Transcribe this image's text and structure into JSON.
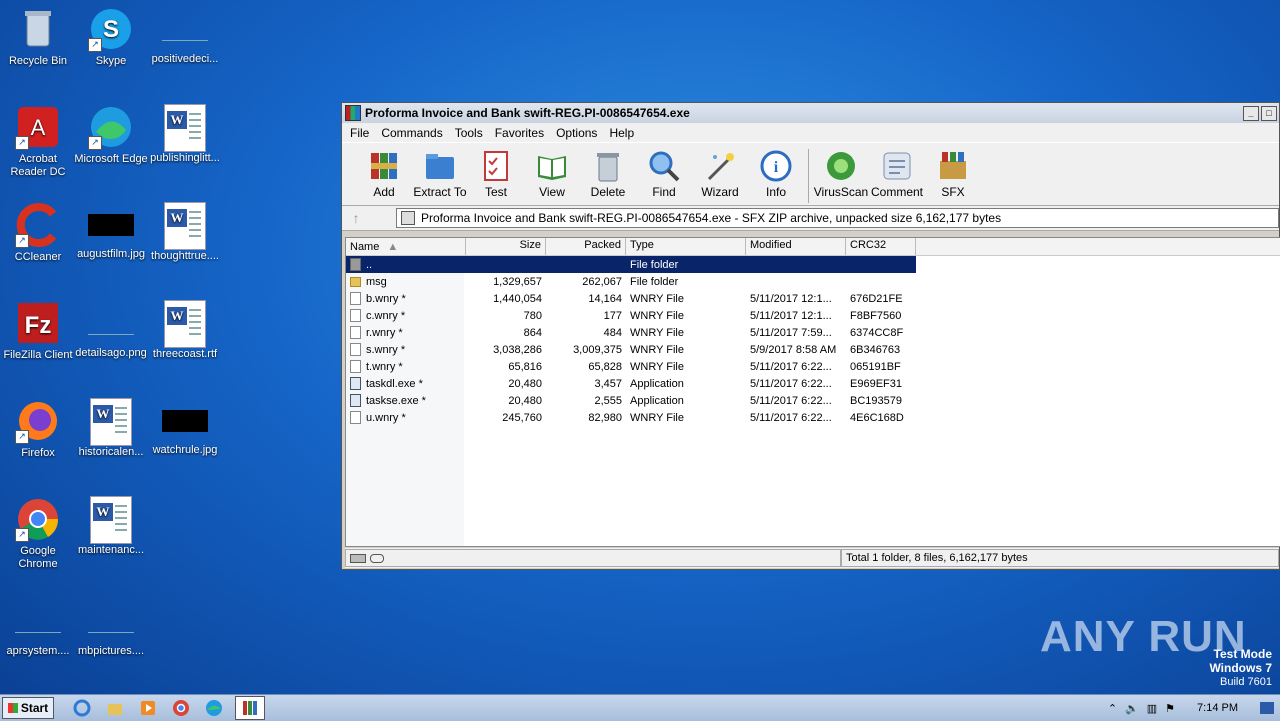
{
  "desktop": {
    "icons": [
      {
        "label": "Recycle Bin",
        "icon": "recycle-bin-icon"
      },
      {
        "label": "Skype",
        "icon": "skype-icon"
      },
      {
        "label": "positivedeci...",
        "icon": "image-file-icon"
      },
      {
        "label": "Acrobat Reader DC",
        "icon": "acrobat-icon"
      },
      {
        "label": "Microsoft Edge",
        "icon": "edge-icon"
      },
      {
        "label": "publishinglitt...",
        "icon": "word-doc-icon"
      },
      {
        "label": "CCleaner",
        "icon": "ccleaner-icon"
      },
      {
        "label": "augustfilm.jpg",
        "icon": "image-file-icon"
      },
      {
        "label": "thoughttrue....",
        "icon": "word-doc-icon"
      },
      {
        "label": "FileZilla Client",
        "icon": "filezilla-icon"
      },
      {
        "label": "detailsago.png",
        "icon": "image-file-icon"
      },
      {
        "label": "threecoast.rtf",
        "icon": "word-doc-icon"
      },
      {
        "label": "Firefox",
        "icon": "firefox-icon"
      },
      {
        "label": "historicalen...",
        "icon": "word-doc-icon"
      },
      {
        "label": "watchrule.jpg",
        "icon": "image-file-icon"
      },
      {
        "label": "Google Chrome",
        "icon": "chrome-icon"
      },
      {
        "label": "maintenanc...",
        "icon": "word-doc-icon"
      },
      {
        "label": "aprsystem....",
        "icon": "image-file-icon"
      },
      {
        "label": "mbpictures....",
        "icon": "image-file-icon"
      }
    ]
  },
  "window": {
    "title": "Proforma Invoice and Bank swift-REG.PI-0086547654.exe",
    "menu": [
      "File",
      "Commands",
      "Tools",
      "Favorites",
      "Options",
      "Help"
    ],
    "toolbar": [
      {
        "label": "Add",
        "icon": "add-archive-icon",
        "color": "#b8342a"
      },
      {
        "label": "Extract To",
        "icon": "extract-folder-icon",
        "color": "#3a7fd0"
      },
      {
        "label": "Test",
        "icon": "test-checklist-icon",
        "color": "#c43a3a"
      },
      {
        "label": "View",
        "icon": "view-book-icon",
        "color": "#3a8a3a"
      },
      {
        "label": "Delete",
        "icon": "trash-icon",
        "color": "#8a96a6"
      },
      {
        "label": "Find",
        "icon": "magnifier-icon",
        "color": "#2f6fc0"
      },
      {
        "label": "Wizard",
        "icon": "wand-icon",
        "color": "#6aa0d8"
      },
      {
        "label": "Info",
        "icon": "info-icon",
        "color": "#2d6cc4"
      },
      {
        "label": "VirusScan",
        "icon": "virus-scan-icon",
        "color": "#3c9a3c"
      },
      {
        "label": "Comment",
        "icon": "comment-icon",
        "color": "#7a8fb0"
      },
      {
        "label": "SFX",
        "icon": "sfx-box-icon",
        "color": "#c99a44"
      }
    ],
    "address": "Proforma Invoice and Bank swift-REG.PI-0086547654.exe - SFX ZIP archive, unpacked size 6,162,177 bytes",
    "columns": {
      "name": "Name",
      "size": "Size",
      "packed": "Packed",
      "type": "Type",
      "modified": "Modified",
      "crc": "CRC32"
    },
    "files": [
      {
        "name": "..",
        "size": "",
        "packed": "",
        "type": "File folder",
        "modified": "",
        "crc": "",
        "kind": "up"
      },
      {
        "name": "msg",
        "size": "1,329,657",
        "packed": "262,067",
        "type": "File folder",
        "modified": "",
        "crc": "",
        "kind": "folder"
      },
      {
        "name": "b.wnry *",
        "size": "1,440,054",
        "packed": "14,164",
        "type": "WNRY File",
        "modified": "5/11/2017 12:1...",
        "crc": "676D21FE",
        "kind": "file"
      },
      {
        "name": "c.wnry *",
        "size": "780",
        "packed": "177",
        "type": "WNRY File",
        "modified": "5/11/2017 12:1...",
        "crc": "F8BF7560",
        "kind": "file"
      },
      {
        "name": "r.wnry *",
        "size": "864",
        "packed": "484",
        "type": "WNRY File",
        "modified": "5/11/2017 7:59...",
        "crc": "6374CC8F",
        "kind": "file"
      },
      {
        "name": "s.wnry *",
        "size": "3,038,286",
        "packed": "3,009,375",
        "type": "WNRY File",
        "modified": "5/9/2017 8:58 AM",
        "crc": "6B346763",
        "kind": "file"
      },
      {
        "name": "t.wnry *",
        "size": "65,816",
        "packed": "65,828",
        "type": "WNRY File",
        "modified": "5/11/2017 6:22...",
        "crc": "065191BF",
        "kind": "file"
      },
      {
        "name": "taskdl.exe *",
        "size": "20,480",
        "packed": "3,457",
        "type": "Application",
        "modified": "5/11/2017 6:22...",
        "crc": "E969EF31",
        "kind": "app"
      },
      {
        "name": "taskse.exe *",
        "size": "20,480",
        "packed": "2,555",
        "type": "Application",
        "modified": "5/11/2017 6:22...",
        "crc": "BC193579",
        "kind": "app"
      },
      {
        "name": "u.wnry *",
        "size": "245,760",
        "packed": "82,980",
        "type": "WNRY File",
        "modified": "5/11/2017 6:22...",
        "crc": "4E6C168D",
        "kind": "file"
      }
    ],
    "status": "Total 1 folder, 8 files, 6,162,177 bytes"
  },
  "taskbar": {
    "start": "Start",
    "clock": "7:14 PM"
  },
  "watermark": {
    "line1": "Test Mode",
    "line2": "Windows 7",
    "line3": "Build 7601",
    "brand": "ANY RUN"
  }
}
